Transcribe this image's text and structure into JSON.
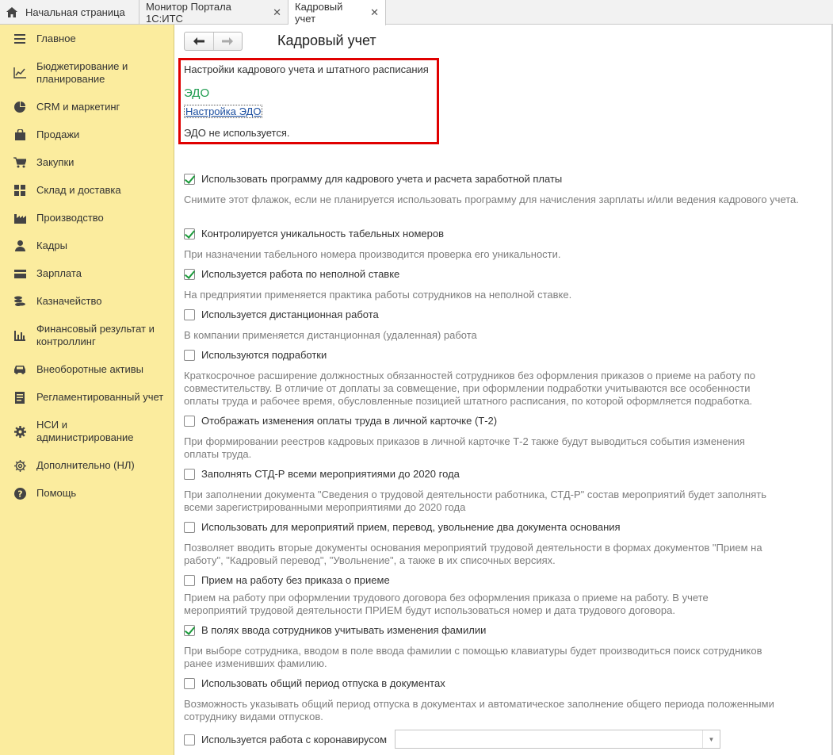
{
  "tabs": [
    {
      "label": "Начальная страница",
      "icon": "home-icon"
    },
    {
      "label": "Монитор Портала 1С:ИТС",
      "close": "✕"
    },
    {
      "label": "Кадровый учет",
      "close": "✕"
    }
  ],
  "sidebar": {
    "items": [
      {
        "label": "Главное",
        "icon": "menu-icon"
      },
      {
        "label": "Бюджетирование и планирование",
        "icon": "chart-line-icon"
      },
      {
        "label": "CRM и маркетинг",
        "icon": "pie-icon"
      },
      {
        "label": "Продажи",
        "icon": "bag-icon"
      },
      {
        "label": "Закупки",
        "icon": "cart-icon"
      },
      {
        "label": "Склад и доставка",
        "icon": "grid-icon"
      },
      {
        "label": "Производство",
        "icon": "factory-icon"
      },
      {
        "label": "Кадры",
        "icon": "person-icon"
      },
      {
        "label": "Зарплата",
        "icon": "card-icon"
      },
      {
        "label": "Казначейство",
        "icon": "coins-icon"
      },
      {
        "label": "Финансовый результат и контроллинг",
        "icon": "bar-chart-icon"
      },
      {
        "label": "Внеоборотные активы",
        "icon": "car-icon"
      },
      {
        "label": "Регламентированный учет",
        "icon": "document-icon"
      },
      {
        "label": "НСИ и администрирование",
        "icon": "gear-icon"
      },
      {
        "label": "Дополнительно (НЛ)",
        "icon": "gear-outline-icon"
      },
      {
        "label": "Помощь",
        "icon": "help-icon"
      }
    ]
  },
  "header": {
    "back": "🡐",
    "forward": "🡒",
    "title": "Кадровый учет"
  },
  "edo": {
    "settings_heading": "Настройки кадрового учета и штатного расписания",
    "title": "ЭДО",
    "link": "Настройка ЭДО",
    "status": "ЭДО не используется."
  },
  "options": [
    {
      "label": "Использовать программу для кадрового учета и расчета заработной платы",
      "checked": true,
      "hint": [
        "Снимите этот флажок, если не планируется использовать программу для начисления зарплаты и/или ведения кадрового учета."
      ]
    },
    {
      "label": "Контролируется уникальность табельных номеров",
      "checked": true,
      "hint": [
        "При назначении табельного номера производится проверка его уникальности."
      ]
    },
    {
      "label": "Используется работа по неполной ставке",
      "checked": true,
      "hint": [
        "На предприятии применяется практика работы сотрудников на неполной ставке."
      ]
    },
    {
      "label": "Используется дистанционная работа",
      "checked": false,
      "hint": [
        "В компании применяется дистанционная (удаленная) работа"
      ]
    },
    {
      "label": "Используются подработки",
      "checked": false,
      "hint": [
        "Краткосрочное расширение должностных обязанностей сотрудников без оформления приказов о приеме на работу по",
        "совместительству. В отличие от доплаты за совмещение, при оформлении подработки учитываются все особенности",
        "оплаты труда и рабочее время, обусловленные позицией штатного расписания, по которой оформляется подработка."
      ]
    },
    {
      "label": "Отображать изменения оплаты труда в личной карточке (Т-2)",
      "checked": false,
      "hint": [
        "При формировании реестров кадровых приказов в личной карточке Т-2 также будут выводиться события изменения",
        "оплаты труда."
      ]
    },
    {
      "label": "Заполнять СТД-Р всеми мероприятиями до 2020 года",
      "checked": false,
      "hint": [
        "При заполнении документа \"Сведения о трудовой деятельности работника, СТД-Р\" состав мероприятий будет заполнять",
        "всеми зарегистрированными мероприятиями до 2020 года"
      ]
    },
    {
      "label": "Использовать для мероприятий прием, перевод, увольнение два документа основания",
      "checked": false,
      "hint": [
        "Позволяет вводить вторые документы основания мероприятий трудовой деятельности в формах документов \"Прием на",
        "работу\", \"Кадровый перевод\", \"Увольнение\", а также в их списочных версиях."
      ]
    },
    {
      "label": "Прием на работу без приказа о приеме",
      "checked": false,
      "hint": [
        "Прием на работу при оформлении трудового договора без оформления приказа о приеме на работу. В учете",
        "мероприятий трудовой деятельности ПРИЕМ будут использоваться номер и дата трудового договора."
      ]
    },
    {
      "label": "В полях ввода сотрудников учитывать изменения фамилии",
      "checked": true,
      "hint": [
        "При выборе сотрудника, вводом в поле ввода фамилии с помощью клавиатуры будет производиться поиск сотрудников",
        "ранее изменивших фамилию."
      ]
    },
    {
      "label": "Использовать общий период отпуска в документах",
      "checked": false,
      "hint": [
        "Возможность указывать общий период отпуска в документах и автоматическое заполнение общего периода положенными",
        "сотруднику видами отпусков."
      ]
    },
    {
      "label": "Используется работа с коронавирусом",
      "checked": false,
      "hint": []
    }
  ],
  "covid_combo": {
    "value": "",
    "arrow": "▼"
  }
}
